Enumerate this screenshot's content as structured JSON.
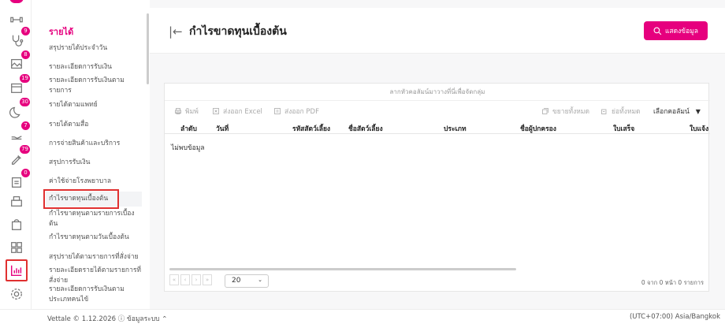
{
  "sidebar": {
    "title": "รายได้",
    "items": [
      {
        "label": "สรุปรายได้ประจำวัน"
      },
      {
        "label": "รายละเอียดการรับเงิน"
      },
      {
        "label": "รายละเอียดการรับเงินตามรายการ"
      },
      {
        "label": "รายได้ตามแพทย์"
      },
      {
        "label": "รายได้ตามสื่อ"
      },
      {
        "label": "การจ่ายสินค้าและบริการ"
      },
      {
        "label": "สรุปการรับเงิน"
      },
      {
        "label": "ค่าใช้จ่ายโรงพยาบาล"
      },
      {
        "label": "กำไรขาดทุนเบื้องต้น"
      },
      {
        "label": "กำไรขาดทุนตามรายการเบื้องต้น"
      },
      {
        "label": "กำไรขาดทุนตามวันเบื้องต้น"
      },
      {
        "label": "สรุปรายได้ตามรายการที่สั่งจ่าย"
      },
      {
        "label": "รายละเอียดรายได้ตามรายการที่สั่งจ่าย"
      },
      {
        "label": "รายละเอียดการรับเงินตามประเภทคนไข้"
      }
    ]
  },
  "rail": {
    "badges": [
      "9",
      "8",
      "19",
      "30",
      "7",
      "79",
      "0"
    ]
  },
  "header": {
    "title": "กำไรขาดทุนเบื้องต้น",
    "show_button": "แสดงข้อมูล"
  },
  "table": {
    "drag_hint": "ลากหัวคอลัมน์มาวางที่นี่เพื่อจัดกลุ่ม",
    "toolbar": {
      "print": "พิมพ์",
      "export_excel": "ส่งออก Excel",
      "export_pdf": "ส่งออก PDF",
      "expand_all": "ขยายทั้งหมด",
      "collapse_all": "ย่อทั้งหมด",
      "choose_columns": "เลือกคอลัมน์"
    },
    "columns": [
      "ลำดับ",
      "วันที่",
      "รหัสสัตว์เลี้ยง",
      "ชื่อสัตว์เลี้ยง",
      "ประเภท",
      "ชื่อผู้ปกครอง",
      "ใบเสร็จ",
      "ใบแจ้ง"
    ],
    "empty_text": "ไม่พบข้อมูล",
    "page_size": "20",
    "pager_info": "0 จาก 0 หน้า 0 รายการ"
  },
  "footer": {
    "left": "Vettale © 1.12.2026 ⓘ ข้อมูลระบบ ⌃",
    "right": "(UTC+07:00) Asia/Bangkok"
  },
  "colors": {
    "accent": "#e6007e",
    "highlight_border": "#e03030"
  }
}
